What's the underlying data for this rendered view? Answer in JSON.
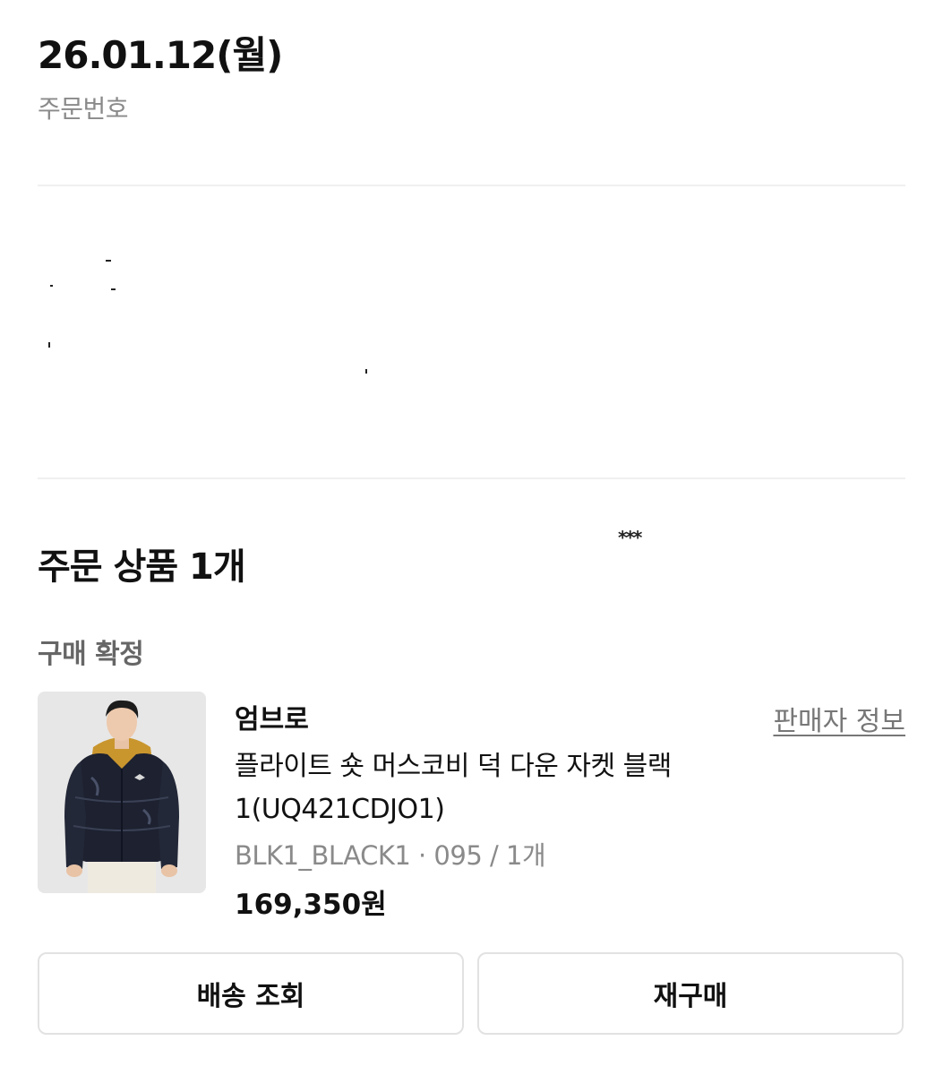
{
  "order": {
    "date": "26.01.12(월)",
    "number_label": "주문번호",
    "masked_name": "*** "
  },
  "items_section": {
    "title": "주문 상품 1개",
    "status": "구매 확정"
  },
  "product": {
    "image_icon": "puffer-jacket-photo",
    "brand": "엄브로",
    "seller_info_label": "판매자 정보",
    "name": "플라이트 숏 머스코비 덕 다운 자켓 블랙 1(UQ421CDJO1)",
    "option": "BLK1_BLACK1 · 095 / 1개",
    "price": "169,350원"
  },
  "actions": {
    "track_delivery": "배송 조회",
    "repurchase": "재구매"
  }
}
